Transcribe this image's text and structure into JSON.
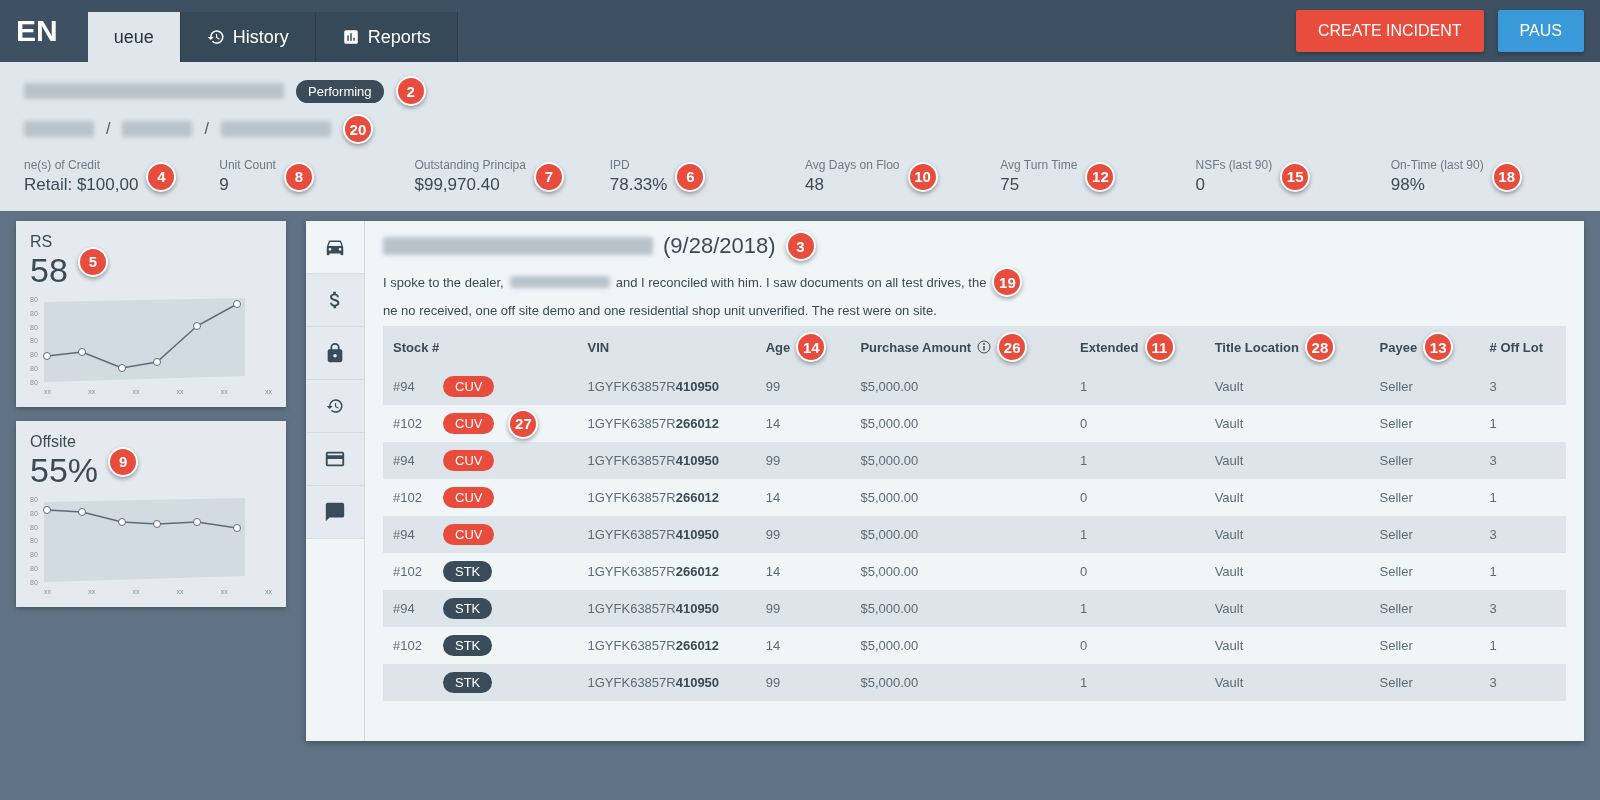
{
  "brand": "EN",
  "tabs": [
    {
      "label": "ueue",
      "selected": true
    },
    {
      "label": "History",
      "selected": false
    },
    {
      "label": "Reports",
      "selected": false
    }
  ],
  "actions": [
    {
      "label": "CREATE INCIDENT",
      "color": "#e84c3d"
    },
    {
      "label": "PAUS",
      "color": "#3a9ad9"
    }
  ],
  "header": {
    "status": "Performing",
    "status_marker": "2",
    "name_marker": "20",
    "separators": [
      "/",
      "/"
    ],
    "stats": [
      {
        "label": "ne(s) of Credit",
        "value": "Retail: $100,00",
        "marker": "4"
      },
      {
        "label": "Unit Count",
        "value": "9",
        "marker": "8"
      },
      {
        "label": "Outstanding Principa",
        "value": "$99,970.40",
        "marker": "7"
      },
      {
        "label": "IPD",
        "value": "78.33%",
        "marker": "6"
      },
      {
        "label": "Avg Days on Floo",
        "value": "48",
        "marker": "10"
      },
      {
        "label": "Avg Turn Time",
        "value": "75",
        "marker": "12"
      },
      {
        "label": "NSFs (last 90)",
        "value": "0",
        "marker": "15"
      },
      {
        "label": "On-Time (last 90)",
        "value": "98%",
        "marker": "18"
      }
    ]
  },
  "cards": [
    {
      "title": "RS",
      "value": "58",
      "marker": "5",
      "y_labels": [
        "80",
        "80",
        "80",
        "80",
        "80",
        "80",
        "80"
      ],
      "x_labels": [
        "xx",
        "xx",
        "xx",
        "xx",
        "xx",
        "xx"
      ]
    },
    {
      "title": "Offsite",
      "value": "55%",
      "marker": "9",
      "y_labels": [
        "80",
        "80",
        "80",
        "80",
        "80",
        "80",
        "80"
      ],
      "x_labels": [
        "xx",
        "xx",
        "xx",
        "xx",
        "xx",
        "xx"
      ]
    }
  ],
  "rail": [
    {
      "selected": true
    },
    {
      "selected": false
    },
    {
      "selected": false
    },
    {
      "selected": false
    },
    {
      "selected": false
    },
    {
      "selected": false
    }
  ],
  "note": {
    "date": "(9/28/2018)",
    "date_marker": "3",
    "parts": [
      "I spoke to the dealer,",
      "and I reconciled with him. I saw documents on all test drives, the",
      "ne no received, one off site demo and one residential shop unit unverified. The rest were on site."
    ],
    "marker": "19"
  },
  "table": {
    "columns": [
      {
        "label": "Stock #"
      },
      {
        "label": "VIN"
      },
      {
        "label": "Age",
        "marker": "14"
      },
      {
        "label": "Purchase Amount",
        "info": true,
        "marker": "26"
      },
      {
        "label": "Extended",
        "marker": "11"
      },
      {
        "label": "Title Location",
        "marker": "28"
      },
      {
        "label": "Payee",
        "marker": "13"
      },
      {
        "label": "# Off Lot"
      }
    ],
    "rows": [
      {
        "stock": "#94",
        "tag": {
          "label": "CUV",
          "color": "#e84c3d"
        },
        "vin": "1GYFK63857R**410950**",
        "age": "99",
        "amount": "$5,000.00",
        "extended": "1",
        "title": "Vault",
        "payee": "Seller",
        "off_lot": "3"
      },
      {
        "stock": "#102",
        "tag": {
          "label": "CUV",
          "color": "#e84c3d"
        },
        "vin": "1GYFK63857R**266012**",
        "age": "14",
        "amount": "$5,000.00",
        "extended": "0",
        "title": "Vault",
        "payee": "Seller",
        "off_lot": "1",
        "marker": "27"
      },
      {
        "stock": "#94",
        "tag": {
          "label": "CUV",
          "color": "#e84c3d"
        },
        "vin": "1GYFK63857R**410950**",
        "age": "99",
        "amount": "$5,000.00",
        "extended": "1",
        "title": "Vault",
        "payee": "Seller",
        "off_lot": "3"
      },
      {
        "stock": "#102",
        "tag": {
          "label": "CUV",
          "color": "#e84c3d"
        },
        "vin": "1GYFK63857R**266012**",
        "age": "14",
        "amount": "$5,000.00",
        "extended": "0",
        "title": "Vault",
        "payee": "Seller",
        "off_lot": "1"
      },
      {
        "stock": "#94",
        "tag": {
          "label": "CUV",
          "color": "#e84c3d"
        },
        "vin": "1GYFK63857R**410950**",
        "age": "99",
        "amount": "$5,000.00",
        "extended": "1",
        "title": "Vault",
        "payee": "Seller",
        "off_lot": "3"
      },
      {
        "stock": "#102",
        "tag": {
          "label": "STK",
          "color": "#3a4b59"
        },
        "vin": "1GYFK63857R**266012**",
        "age": "14",
        "amount": "$5,000.00",
        "extended": "0",
        "title": "Vault",
        "payee": "Seller",
        "off_lot": "1"
      },
      {
        "stock": "#94",
        "tag": {
          "label": "STK",
          "color": "#3a4b59"
        },
        "vin": "1GYFK63857R**410950**",
        "age": "99",
        "amount": "$5,000.00",
        "extended": "1",
        "title": "Vault",
        "payee": "Seller",
        "off_lot": "3"
      },
      {
        "stock": "#102",
        "tag": {
          "label": "STK",
          "color": "#3a4b59"
        },
        "vin": "1GYFK63857R**266012**",
        "age": "14",
        "amount": "$5,000.00",
        "extended": "0",
        "title": "Vault",
        "payee": "Seller",
        "off_lot": "1"
      },
      {
        "tag": {
          "label": "STK",
          "color": "#3a4b59"
        },
        "vin": "1GYFK63857R**410950**",
        "age": "99",
        "amount": "$5,000.00",
        "extended": "1",
        "title": "Vault",
        "payee": "Seller",
        "off_lot": "3"
      }
    ]
  }
}
